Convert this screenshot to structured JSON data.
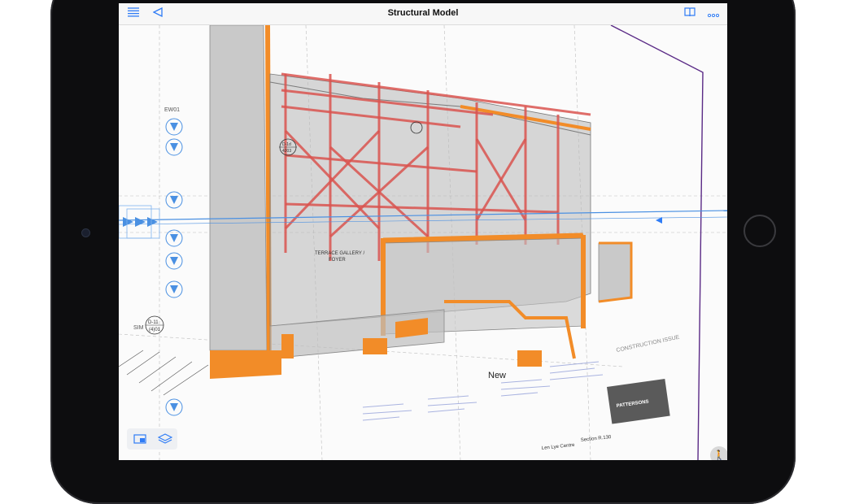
{
  "app": {
    "title": "Structural Model",
    "icons": [
      "list-icon",
      "back-arrow-icon",
      "book-icon",
      "more-icon"
    ]
  },
  "model_labels": {
    "gallery_line1": "TERRACE GALLERY /",
    "gallery_line2": "FOYER",
    "ew_tag": "EW01",
    "sim_tag": "SIM",
    "section_top": "D-11",
    "section_bottom": "(4)01",
    "section_top_2": "D-1d",
    "section_bottom_2": "4203",
    "new_label": "New",
    "construction_issue": "CONSTRUCTION ISSUE",
    "company": "PATTERSONS",
    "project": "Len Lye Centre",
    "section_ref": "Section R.130"
  },
  "colors": {
    "accent": "#2f7cf6",
    "steel": "#d9534f",
    "concrete_edge": "#f28c28",
    "grid_blue": "#4a90e2",
    "violet_frame": "#5a2a86"
  },
  "toolbar": {
    "bottom_icons": [
      "sheet-view-icon",
      "layers-icon"
    ],
    "walk_icon": "walk-person-icon"
  }
}
